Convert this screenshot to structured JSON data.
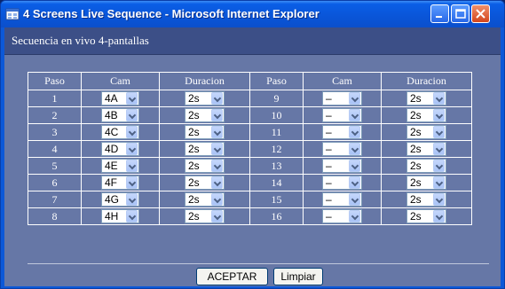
{
  "window": {
    "title": "4 Screens Live Sequence - Microsoft Internet Explorer"
  },
  "header": {
    "title": "Secuencia en vivo 4-pantallas"
  },
  "table": {
    "headers": [
      "Paso",
      "Cam",
      "Duracion",
      "Paso",
      "Cam",
      "Duracion"
    ],
    "rows": [
      {
        "paso_a": "1",
        "cam_a": "4A",
        "dur_a": "2s",
        "paso_b": "9",
        "cam_b": "–",
        "dur_b": "2s"
      },
      {
        "paso_a": "2",
        "cam_a": "4B",
        "dur_a": "2s",
        "paso_b": "10",
        "cam_b": "–",
        "dur_b": "2s"
      },
      {
        "paso_a": "3",
        "cam_a": "4C",
        "dur_a": "2s",
        "paso_b": "11",
        "cam_b": "–",
        "dur_b": "2s"
      },
      {
        "paso_a": "4",
        "cam_a": "4D",
        "dur_a": "2s",
        "paso_b": "12",
        "cam_b": "–",
        "dur_b": "2s"
      },
      {
        "paso_a": "5",
        "cam_a": "4E",
        "dur_a": "2s",
        "paso_b": "13",
        "cam_b": "–",
        "dur_b": "2s"
      },
      {
        "paso_a": "6",
        "cam_a": "4F",
        "dur_a": "2s",
        "paso_b": "14",
        "cam_b": "–",
        "dur_b": "2s"
      },
      {
        "paso_a": "7",
        "cam_a": "4G",
        "dur_a": "2s",
        "paso_b": "15",
        "cam_b": "–",
        "dur_b": "2s"
      },
      {
        "paso_a": "8",
        "cam_a": "4H",
        "dur_a": "2s",
        "paso_b": "16",
        "cam_b": "–",
        "dur_b": "2s"
      }
    ]
  },
  "buttons": {
    "accept": "ACEPTAR",
    "clear": "Limpiar"
  },
  "icons": {
    "app": "ie-window-icon",
    "minimize": "minimize-icon",
    "maximize": "maximize-icon",
    "close": "close-icon",
    "dropdown": "chevron-down-icon"
  },
  "colors": {
    "titlebar": "#0a55d8",
    "header": "#3c4f87",
    "body": "#6677a6",
    "close_button": "#d3451c"
  }
}
